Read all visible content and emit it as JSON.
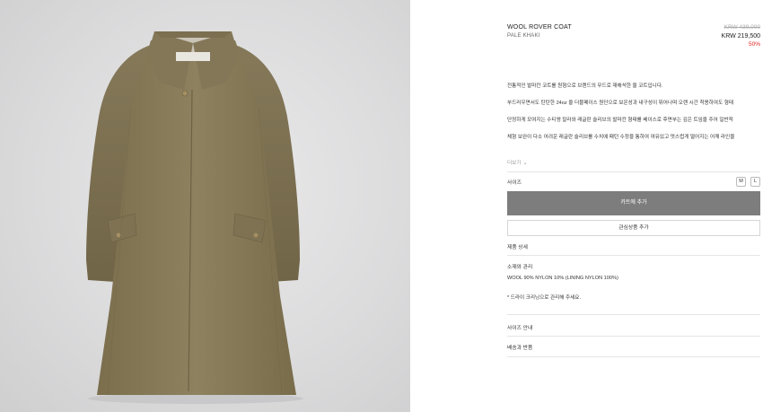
{
  "product": {
    "name": "WOOL ROVER COAT",
    "color": "PALE KHAKI",
    "price_original": "KRW 439,000",
    "price_sale": "KRW 219,500",
    "discount": "50%"
  },
  "description": {
    "lines": [
      "전통적인 발마칸 코트를 원형으로 브랜드의 무드로 재해석한 울 코트입니다.",
      "부드러우면서도 탄탄한 24oz 울 더블페이스 원단으로 보온성과 내구성이 뛰어나며 오랜 시간 착용하여도 형태",
      "단정하게 모여지는 수티엥 칼라와 래글란 슬리브의 발마칸 형태를 베이스로 후면부는 깊은 트임을 주어 일반적",
      "체형 보완이 다소 어려운 래글란 슬리브를 수치에 패턴 수정을 통하여 여유있고 멋스럽게 떨어지는 어깨 라인을"
    ],
    "more_label": "더보기"
  },
  "size": {
    "label": "사이즈",
    "options": [
      "M",
      "L"
    ]
  },
  "buttons": {
    "add_to_cart": "카트에 추가",
    "add_to_wishlist": "관심상품 추가"
  },
  "details": {
    "title": "제품 상세",
    "material_title": "소재와 관리",
    "material_value": "WOOL 90% NYLON 10% (LINING NYLON 100%)",
    "care_note": "* 드라이 크리닝으로 관리해 주세요.",
    "size_guide": "사이즈 안내",
    "shipping_returns": "배송과 반품"
  },
  "image": {
    "subject": "coat-photo",
    "coat_color": "#8a7d5a",
    "background_color": "#dcdcdd"
  }
}
